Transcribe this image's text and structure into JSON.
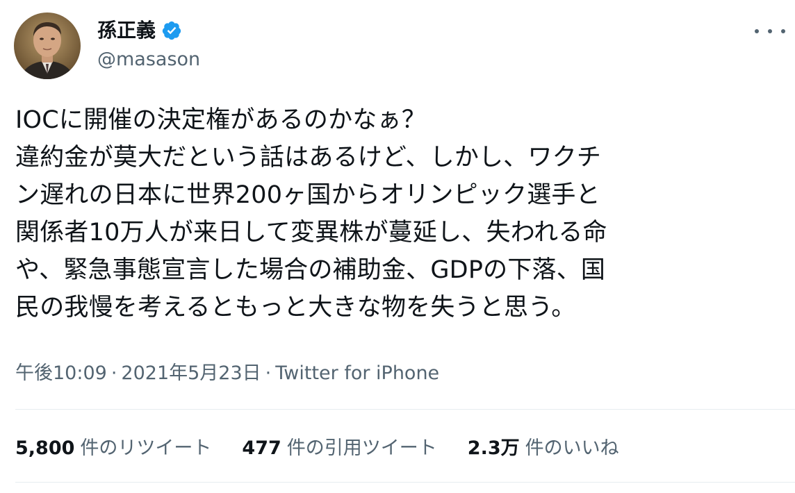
{
  "author": {
    "display_name": "孫正義",
    "handle": "@masason",
    "verified_icon": "verified-badge-icon",
    "verified_color": "#1d9bf0"
  },
  "more_icon": "more-horizontal-icon",
  "tweet": {
    "lines": [
      "IOCに開催の決定権があるのかなぁ？",
      "違約金が莫大だという話はあるけど、しかし、ワクチ",
      "ン遅れの日本に世界200ヶ国からオリンピック選手と",
      "関係者10万人が来日して変異株が蔓延し、失われる命",
      "や、緊急事態宣言した場合の補助金、GDPの下落、国",
      "民の我慢を考えるともっと大きな物を失うと思う。"
    ]
  },
  "meta": {
    "time": "午後10:09",
    "separator": "·",
    "date": "2021年5月23日",
    "source": "Twitter for iPhone"
  },
  "stats": {
    "retweets": {
      "count": "5,800",
      "label": "件のリツイート"
    },
    "quotes": {
      "count": "477",
      "label": "件の引用ツイート"
    },
    "likes": {
      "count": "2.3万",
      "label": "件のいいね"
    }
  },
  "colors": {
    "text_primary": "#0f1419",
    "text_secondary": "#536471",
    "divider": "#e6ecf0"
  }
}
